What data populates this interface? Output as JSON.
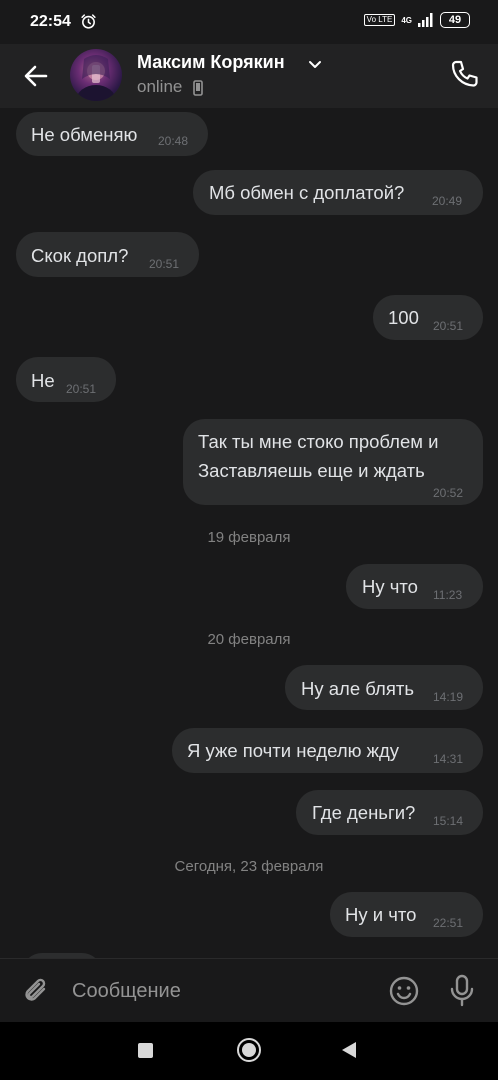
{
  "status_bar": {
    "time": "22:54",
    "volte": "Vo LTE",
    "network": "4G",
    "battery": "49"
  },
  "header": {
    "contact_name": "Максим Корякин",
    "status": "online"
  },
  "messages": [
    {
      "side": "in",
      "text": "Не обменяю",
      "time": "20:48"
    },
    {
      "side": "out",
      "text": "Мб обмен с доплатой?",
      "time": "20:49"
    },
    {
      "side": "in",
      "text": "Скок допл?",
      "time": "20:51"
    },
    {
      "side": "out",
      "text": "100",
      "time": "20:51"
    },
    {
      "side": "in",
      "text": "Не",
      "time": "20:51"
    },
    {
      "side": "out",
      "text": "Так ты мне стоко проблем и Заставляешь еще и ждать",
      "time": "20:52"
    },
    {
      "side": "out",
      "text": "Ну что",
      "time": "11:23"
    },
    {
      "side": "out",
      "text": "Ну але блять",
      "time": "14:19"
    },
    {
      "side": "out",
      "text": "Я уже почти неделю жду",
      "time": "14:31"
    },
    {
      "side": "out",
      "text": "Где деньги?",
      "time": "15:14"
    },
    {
      "side": "out",
      "text": "Ну и что",
      "time": "22:51"
    }
  ],
  "date_separators": [
    "19 февраля",
    "20 февраля",
    "Сегодня, 23 февраля"
  ],
  "composer": {
    "placeholder": "Сообщение"
  },
  "colors": {
    "background": "#19191a",
    "bubble": "#2c2d2e",
    "text": "#e1e3e6",
    "timestamp": "#6d6f73",
    "secondary": "#939393"
  }
}
